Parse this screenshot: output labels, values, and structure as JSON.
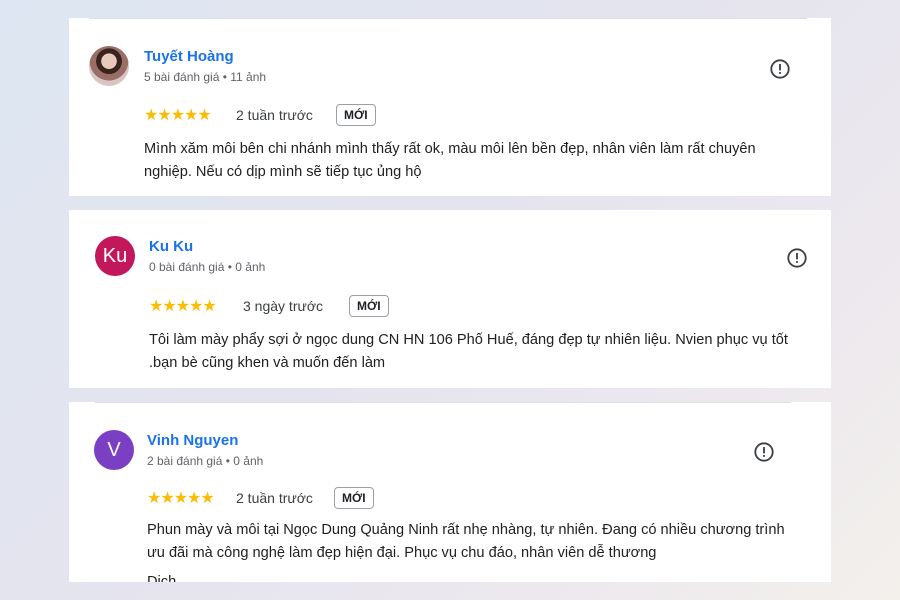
{
  "reviews": [
    {
      "name": "Tuyết Hoàng",
      "meta": "5 bài đánh giá • 11 ảnh",
      "stars": "★★★★★",
      "time": "2 tuần trước",
      "badge": "MỚI",
      "text": "Mình xăm môi bên chi nhánh mình thấy rất ok, màu môi lên bền đẹp, nhân viên làm rất chuyên nghiệp. Nếu có dịp mình sẽ tiếp tục ủng hộ",
      "avatar": "photo",
      "rating": 5
    },
    {
      "name": "Ku Ku",
      "meta": "0 bài đánh giá • 0 ảnh",
      "stars": "★★★★★",
      "time": "3 ngày trước",
      "badge": "MỚI",
      "text": "Tôi làm mày phẩy sợi ở ngọc dung CN HN 106 Phố Huế, đáng đẹp tự nhiên liệu. Nvien phục vụ tốt .bạn bè cũng khen và muốn đến làm",
      "avatar": "Ku",
      "avatar_color": "#c2185b",
      "rating": 5
    },
    {
      "name": "Vinh Nguyen",
      "meta": "2 bài đánh giá • 0 ảnh",
      "stars": "★★★★★",
      "time": "2 tuần trước",
      "badge": "MỚI",
      "text": "Phun mày và môi tại Ngọc Dung Quảng Ninh rất nhẹ nhàng, tự nhiên. Đang có nhiều chương trình ưu đãi mà công nghệ làm đẹp hiện đại. Phục vụ chu đáo, nhân viên dễ thương",
      "avatar": "V",
      "avatar_color": "#7b3fc4",
      "rating": 5,
      "cut_line": "Dịch"
    }
  ],
  "icons": {
    "report": "report-flag-icon",
    "star": "star-icon"
  },
  "colors": {
    "name": "#1a73e8",
    "star": "#fbbc04"
  }
}
